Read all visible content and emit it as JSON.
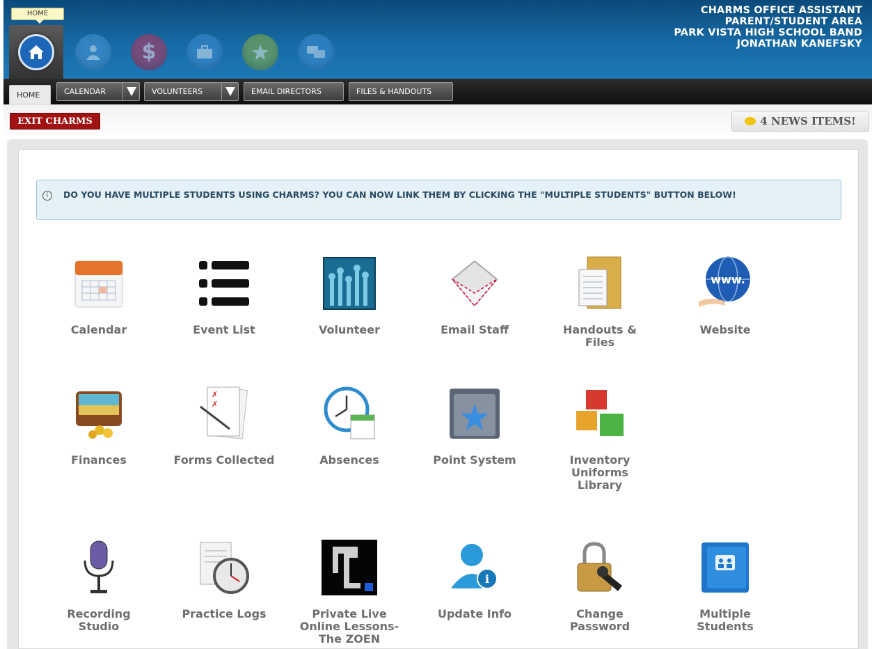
{
  "header": {
    "lines": [
      "CHARMS OFFICE ASSISTANT",
      "PARENT/STUDENT AREA",
      "PARK VISTA HIGH SCHOOL BAND",
      "JONATHAN KANEFSKY"
    ],
    "tooltip": "HOME",
    "icons": [
      "home-icon",
      "person-icon",
      "dollar-icon",
      "briefcase-icon",
      "star-icon",
      "chat-icon"
    ],
    "colors": {
      "header": "#176aa5",
      "exit": "#a31212"
    }
  },
  "nav": {
    "home": "HOME",
    "calendar": "CALENDAR",
    "volunteers": "VOLUNTEERS",
    "email": "EMAIL DIRECTORS",
    "files": "FILES & HANDOUTS"
  },
  "subbar": {
    "exit": "EXIT CHARMS",
    "news": "4 NEWS ITEMS!"
  },
  "alert": {
    "text": "DO YOU HAVE MULTIPLE STUDENTS USING CHARMS? YOU CAN NOW LINK THEM BY CLICKING THE \"MULTIPLE STUDENTS\" BUTTON BELOW!"
  },
  "items": [
    {
      "label": "Calendar",
      "icon": "calendar-icon"
    },
    {
      "label": "Event List",
      "icon": "list-icon"
    },
    {
      "label": "Volunteer",
      "icon": "raised-hands-icon"
    },
    {
      "label": "Email Staff",
      "icon": "envelope-icon"
    },
    {
      "label": "Handouts & Files",
      "icon": "folder-icon"
    },
    {
      "label": "Website",
      "icon": "globe-icon"
    },
    {
      "label": "Finances",
      "icon": "wallet-icon"
    },
    {
      "label": "Forms Collected",
      "icon": "forms-icon"
    },
    {
      "label": "Absences",
      "icon": "clock-icon"
    },
    {
      "label": "Point System",
      "icon": "star-folder-icon"
    },
    {
      "label": "Inventory Uniforms Library",
      "icon": "boxes-icon"
    },
    {
      "label": "Recording Studio",
      "icon": "microphone-icon"
    },
    {
      "label": "Practice Logs",
      "icon": "stopwatch-icon"
    },
    {
      "label": "Private Live Online Lessons- The ZOEN",
      "icon": "zoen-logo-icon"
    },
    {
      "label": "Update Info",
      "icon": "user-info-icon"
    },
    {
      "label": "Change Password",
      "icon": "lock-key-icon"
    },
    {
      "label": "Multiple Students",
      "icon": "group-book-icon"
    }
  ]
}
